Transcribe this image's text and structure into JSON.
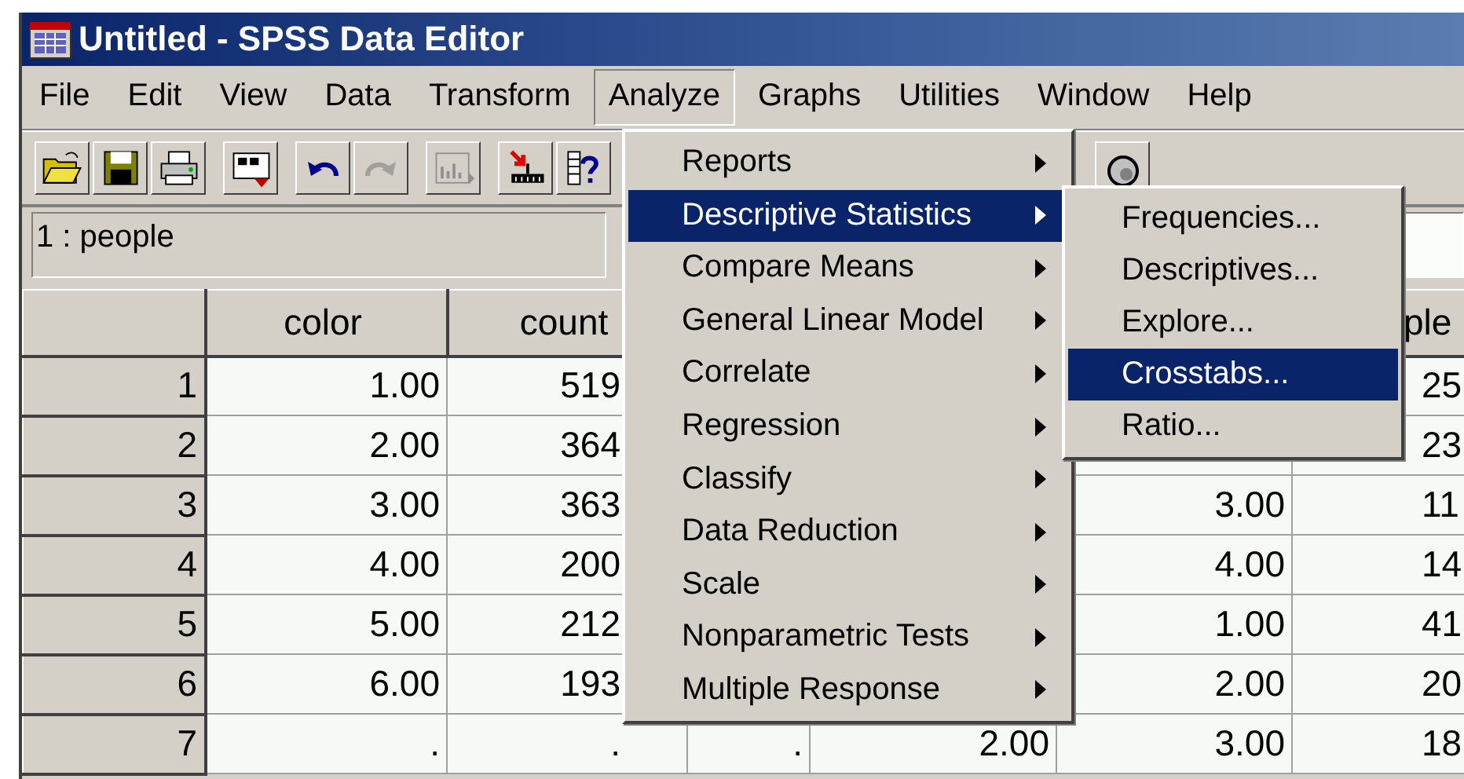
{
  "window": {
    "title": "Untitled - SPSS Data Editor"
  },
  "menubar": [
    {
      "label": "File",
      "selected": false
    },
    {
      "label": "Edit",
      "selected": false
    },
    {
      "label": "View",
      "selected": false
    },
    {
      "label": "Data",
      "selected": false
    },
    {
      "label": "Transform",
      "selected": false
    },
    {
      "label": "Analyze",
      "selected": true
    },
    {
      "label": "Graphs",
      "selected": false
    },
    {
      "label": "Utilities",
      "selected": false
    },
    {
      "label": "Window",
      "selected": false
    },
    {
      "label": "Help",
      "selected": false
    }
  ],
  "cell_reference": "1 : people",
  "grid": {
    "columns": [
      "color",
      "count",
      null,
      null,
      null,
      "ple"
    ],
    "rows": [
      {
        "number": "1",
        "cells": [
          "1.00",
          "519",
          null,
          null,
          null,
          "25"
        ]
      },
      {
        "number": "2",
        "cells": [
          "2.00",
          "364",
          null,
          null,
          null,
          "23"
        ]
      },
      {
        "number": "3",
        "cells": [
          "3.00",
          "363",
          null,
          null,
          "3.00",
          "11"
        ]
      },
      {
        "number": "4",
        "cells": [
          "4.00",
          "200",
          null,
          null,
          "4.00",
          "14"
        ]
      },
      {
        "number": "5",
        "cells": [
          "5.00",
          "212",
          null,
          null,
          "1.00",
          "41"
        ]
      },
      {
        "number": "6",
        "cells": [
          "6.00",
          "193",
          null,
          null,
          "2.00",
          "20"
        ]
      },
      {
        "number": "7",
        "cells": [
          ".",
          ".",
          ".",
          "2.00",
          "3.00",
          "18"
        ]
      }
    ]
  },
  "analyze_menu": [
    {
      "label": "Reports",
      "selected": false,
      "has_submenu": true
    },
    {
      "label": "Descriptive Statistics",
      "selected": true,
      "has_submenu": true,
      "children": [
        {
          "label": "Frequencies...",
          "selected": false
        },
        {
          "label": "Descriptives...",
          "selected": false
        },
        {
          "label": "Explore...",
          "selected": false
        },
        {
          "label": "Crosstabs...",
          "selected": true
        },
        {
          "label": "Ratio...",
          "selected": false
        }
      ]
    },
    {
      "label": "Compare Means",
      "selected": false,
      "has_submenu": true
    },
    {
      "label": "General Linear Model",
      "selected": false,
      "has_submenu": true
    },
    {
      "label": "Correlate",
      "selected": false,
      "has_submenu": true
    },
    {
      "label": "Regression",
      "selected": false,
      "has_submenu": true
    },
    {
      "label": "Classify",
      "selected": false,
      "has_submenu": true
    },
    {
      "label": "Data Reduction",
      "selected": false,
      "has_submenu": true
    },
    {
      "label": "Scale",
      "selected": false,
      "has_submenu": true
    },
    {
      "label": "Nonparametric Tests",
      "selected": false,
      "has_submenu": true
    },
    {
      "label": "Multiple Response",
      "selected": false,
      "has_submenu": true
    }
  ]
}
